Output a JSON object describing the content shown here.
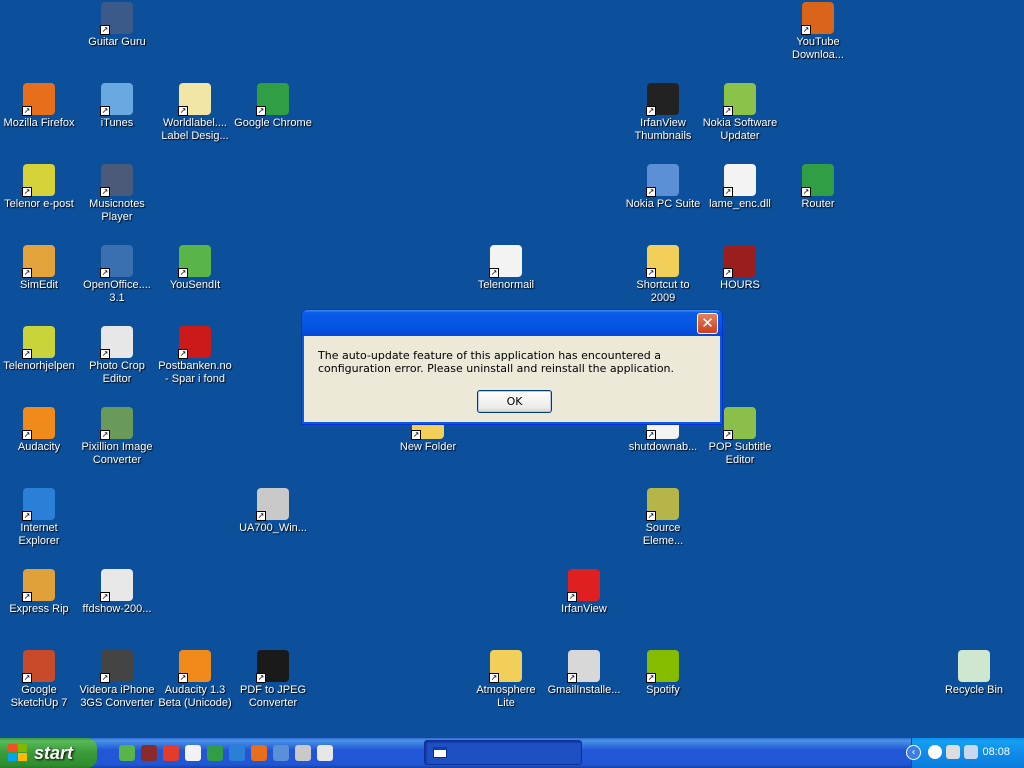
{
  "desktop": {
    "icons": [
      {
        "id": "guitar-guru",
        "label": "Guitar Guru",
        "color": "#3b5a8a"
      },
      {
        "id": "youtube-downloader",
        "label": "YouTube Downloa...",
        "color": "#d9641a"
      },
      {
        "id": "mozilla-firefox",
        "label": "Mozilla Firefox",
        "color": "#e76f1b"
      },
      {
        "id": "itunes",
        "label": "iTunes",
        "color": "#6aa8e0"
      },
      {
        "id": "worldlabel",
        "label": "Worldlabel.... Label Desig...",
        "color": "#f2e6a6"
      },
      {
        "id": "google-chrome",
        "label": "Google Chrome",
        "color": "#2f9e44"
      },
      {
        "id": "irfanview-thumbnails",
        "label": "IrfanView Thumbnails",
        "color": "#222222"
      },
      {
        "id": "nokia-software-updater",
        "label": "Nokia Software Updater",
        "color": "#8bc34a"
      },
      {
        "id": "telenor-epost",
        "label": "Telenor e-post",
        "color": "#d6d23a"
      },
      {
        "id": "musicnotes-player",
        "label": "Musicnotes Player",
        "color": "#4a5a78"
      },
      {
        "id": "nokia-pc-suite",
        "label": "Nokia PC Suite",
        "color": "#5b8fd6"
      },
      {
        "id": "lame-enc",
        "label": "lame_enc.dll",
        "color": "#f3f3f3"
      },
      {
        "id": "router",
        "label": "Router",
        "color": "#2f9e44"
      },
      {
        "id": "simedit",
        "label": "SimEdit",
        "color": "#e2a33a"
      },
      {
        "id": "openoffice",
        "label": "OpenOffice.... 3.1",
        "color": "#3a6fb0"
      },
      {
        "id": "yousendit",
        "label": "YouSendIt",
        "color": "#59b548"
      },
      {
        "id": "telenormail",
        "label": "Telenormail",
        "color": "#f3f3f3"
      },
      {
        "id": "shortcut-2009",
        "label": "Shortcut to 2009",
        "color": "#f2cf58"
      },
      {
        "id": "hours",
        "label": "HOURS",
        "color": "#9a1e1e"
      },
      {
        "id": "telenorhjelpen",
        "label": "Telenorhjelpen",
        "color": "#c8d43a"
      },
      {
        "id": "photo-crop-editor",
        "label": "Photo Crop Editor",
        "color": "#e7e7e7"
      },
      {
        "id": "postbanken",
        "label": "Postbanken.no - Spar i fond",
        "color": "#cc1a1a"
      },
      {
        "id": "audacity",
        "label": "Audacity",
        "color": "#f08a1a"
      },
      {
        "id": "pixillion",
        "label": "Pixillion Image Converter",
        "color": "#6a9a5a"
      },
      {
        "id": "new-folder",
        "label": "New Folder",
        "color": "#f2cf58"
      },
      {
        "id": "shutdownab",
        "label": "shutdownab...",
        "color": "#f3f3f3"
      },
      {
        "id": "pop-subtitle-editor",
        "label": "POP Subtitle Editor",
        "color": "#8ac04a"
      },
      {
        "id": "internet-explorer",
        "label": "Internet Explorer",
        "color": "#2a7fd6"
      },
      {
        "id": "ua700",
        "label": "UA700_Win...",
        "color": "#c9c9c9"
      },
      {
        "id": "source-elements",
        "label": "Source Eleme...",
        "color": "#b5b54a"
      },
      {
        "id": "express-rip",
        "label": "Express Rip",
        "color": "#e0a03a"
      },
      {
        "id": "ffdshow",
        "label": "ffdshow-200...",
        "color": "#e8e8e8"
      },
      {
        "id": "irfanview",
        "label": "IrfanView",
        "color": "#e02020"
      },
      {
        "id": "google-sketchup",
        "label": "Google SketchUp 7",
        "color": "#c94a2a"
      },
      {
        "id": "videora",
        "label": "Videora iPhone 3GS Converter",
        "color": "#444444"
      },
      {
        "id": "audacity-13",
        "label": "Audacity 1.3 Beta (Unicode)",
        "color": "#f08a1a"
      },
      {
        "id": "pdf-to-jpeg",
        "label": "PDF to JPEG Converter",
        "color": "#1a1a1a"
      },
      {
        "id": "atmosphere-lite",
        "label": "Atmosphere Lite",
        "color": "#f2cf58"
      },
      {
        "id": "gmail-installer",
        "label": "GmailInstalle...",
        "color": "#d8d8d8"
      },
      {
        "id": "spotify",
        "label": "Spotify",
        "color": "#84bd00"
      },
      {
        "id": "recycle-bin",
        "label": "Recycle Bin",
        "color": "#cfe7cf"
      }
    ]
  },
  "dialog": {
    "message": "The auto-update feature of this application has encountered a configuration error. Please uninstall and reinstall the application.",
    "ok_label": "OK",
    "close_label": "✕"
  },
  "taskbar": {
    "start_label": "start",
    "clock": "08:08",
    "tray_arrow": "‹",
    "quicklaunch": [
      {
        "id": "ql-1",
        "color": "#59b548"
      },
      {
        "id": "ql-2",
        "color": "#8a2a2a"
      },
      {
        "id": "ql-3",
        "color": "#e53b2b"
      },
      {
        "id": "ql-4",
        "color": "#f2f2f2"
      },
      {
        "id": "ql-5",
        "color": "#2f9e44"
      },
      {
        "id": "ql-6",
        "color": "#2a7fd6"
      },
      {
        "id": "ql-7",
        "color": "#e76f1b"
      },
      {
        "id": "ql-8",
        "color": "#5b8fd6"
      },
      {
        "id": "ql-9",
        "color": "#c9c9c9"
      },
      {
        "id": "ql-10",
        "color": "#e7e7e7"
      }
    ]
  }
}
